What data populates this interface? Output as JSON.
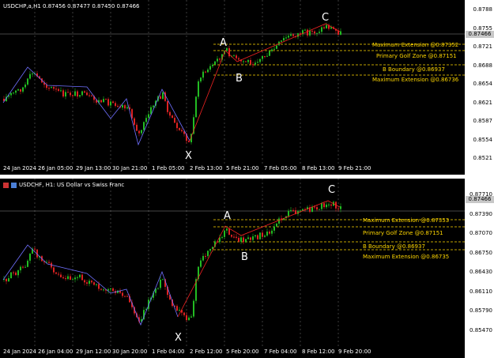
{
  "top": {
    "title": "USDCHP,a,H1  0.87456 0.87477 0.87450 0.87466",
    "y_ticks": [
      "0.8788",
      "0.8755",
      "0.8721",
      "0.8688",
      "0.8654",
      "0.8621",
      "0.8587",
      "0.8554",
      "0.8521"
    ],
    "current_price": "0.87466",
    "x_ticks": [
      "24 Jan 2024",
      "26 Jan 05:00",
      "29 Jan 13:00",
      "30 Jan 21:00",
      "1 Feb 05:00",
      "2 Feb 13:00",
      "5 Feb 21:00",
      "7 Feb 05:00",
      "8 Feb 13:00",
      "9 Feb 21:00"
    ],
    "points": {
      "A": "A",
      "B": "B",
      "C": "C",
      "X": "X"
    },
    "levels": [
      "Maximum Extension @0.87352",
      "Primary Golf Zone @0.87151",
      "B Boundary @0.86937",
      "Maximum Extension @0.86736"
    ]
  },
  "bottom": {
    "title": "USDCHF, H1:  US Dollar vs Swiss Franc",
    "y_ticks": [
      "0.87710",
      "0.87390",
      "0.87070",
      "0.86750",
      "0.86430",
      "0.86110",
      "0.85790",
      "0.85470"
    ],
    "current_price": "0.87466",
    "x_ticks": [
      "24 Jan 2024",
      "26 Jan 04:00",
      "29 Jan 12:00",
      "30 Jan 20:00",
      "1 Feb 04:00",
      "2 Feb 12:00",
      "5 Feb 20:00",
      "7 Feb 04:00",
      "8 Feb 12:00",
      "9 Feb 20:00"
    ],
    "points": {
      "A": "A",
      "B": "B",
      "C": "C",
      "X": "X"
    },
    "levels": [
      "Maximum Extension @0.87353",
      "Primary Golf Zone @0.87151",
      "B Boundary @0.86937",
      "Maximum Extension @0.86735"
    ]
  },
  "colors": {
    "bull": "#22bb22",
    "bear": "#dd2222",
    "harmonic": "#7070ff",
    "leg": "#ee2222",
    "level": "#ffd700"
  }
}
